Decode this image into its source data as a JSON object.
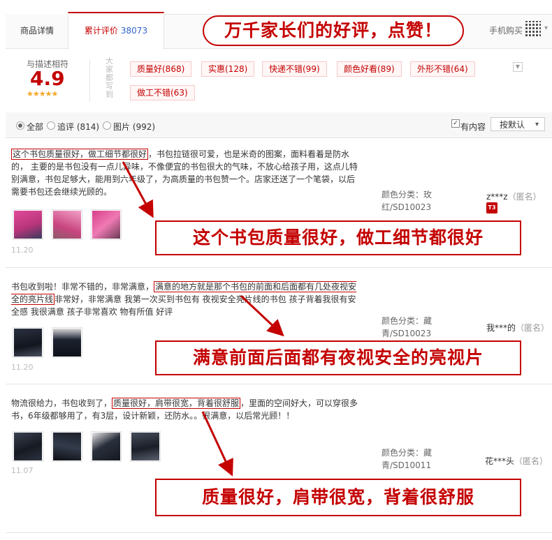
{
  "tabs": {
    "details": "商品详情",
    "reviews": "累计评价",
    "reviews_count": "38073"
  },
  "banner": "万千家长们的好评，点赞！",
  "mobile_buy": "手机购买",
  "summary": {
    "desc_label": "与描述相符",
    "score": "4.9",
    "stars": "★★★★★",
    "everyone_said": "大家都写到",
    "tags": [
      "质量好(868)",
      "实惠(128)",
      "快递不错(99)",
      "颜色好看(89)",
      "外形不错(64)",
      "做工不错(63)"
    ]
  },
  "filters": {
    "all": "全部",
    "followup": "追评 (814)",
    "pictures": "图片 (992)",
    "has_content": "有内容",
    "sort": "按默认"
  },
  "reviews": [
    {
      "highlight": "这个书包质量很好，做工细节都很好",
      "text": "，书包拉链很可爱，也是米奇的图案，面料看着是防水的，  主要的是书包没有一点儿异味，不像便宜的书包很大的气味，不放心给孩子用，这点儿特别满意，书包足够大，能用到六年级了，为高质量的书包赞一个。店家还送了一个笔袋，以后需要书包还会继续光顾的。",
      "sku": "颜色分类：玫红/SD10023",
      "user": "z***z",
      "anon": "（匿名）",
      "level": "T3",
      "date": "11.20",
      "callout": "这个书包质量很好，做工细节都很好"
    },
    {
      "pre": "书包收到啦！非常不错的，非常满意，",
      "highlight": "满意的地方就是那个书包的前面和后面都有几处夜视安全的亮片线",
      "text": "非常好，非常满意 我第一次买到书包有 夜视安全亮片线的书包 孩子背着我很有安全感 我很满意 孩子非常喜欢 物有所值 好评",
      "sku": "颜色分类：藏青/SD10023",
      "user": "我***的",
      "anon": "（匿名）",
      "date": "11.20",
      "callout": "满意前面后面都有夜视安全的亮视片"
    },
    {
      "pre": "物流很给力，书包收到了，",
      "highlight": "质量很好，肩带很宽，背着很舒服",
      "text": "，里面的空间好大，可以穿很多书，6年级都够用了，有3层，设计新颖，还防水。。很满意，以后常光顾！！",
      "sku": "颜色分类：藏青/SD10011",
      "user": "花***头",
      "anon": "（匿名）",
      "date": "11.07",
      "callout": "质量很好，肩带很宽，背着很舒服"
    }
  ],
  "colors": {
    "accent": "#c40000",
    "link": "#3366cc",
    "star": "#f5a623"
  }
}
